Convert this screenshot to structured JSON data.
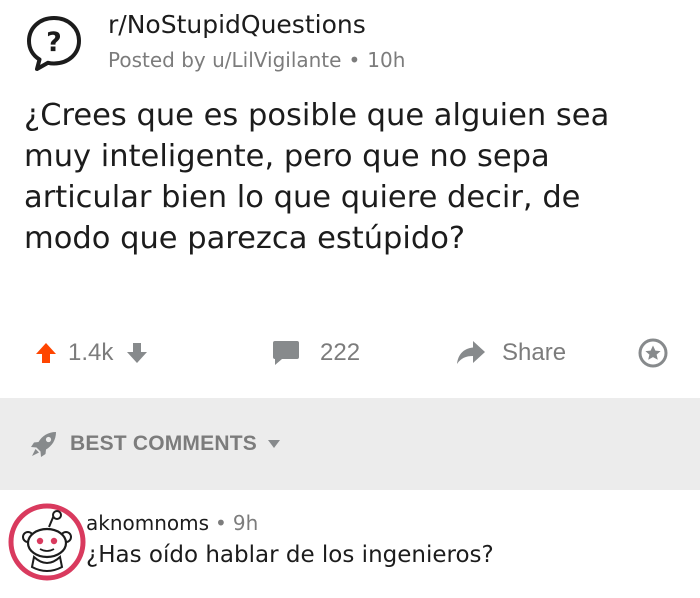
{
  "post": {
    "subreddit": "r/NoStupidQuestions",
    "posted_by_prefix": "Posted by ",
    "author": "u/LilVigilante",
    "separator": "•",
    "age": "10h",
    "title": "¿Crees que es posible que alguien sea muy inteligente, pero que no sepa articular bien lo que quiere decir, de modo que parezca estúpido?"
  },
  "actions": {
    "score": "1.4k",
    "comments": "222",
    "share": "Share"
  },
  "sort": {
    "label": "BEST COMMENTS"
  },
  "comment": {
    "username": "aknomnoms",
    "separator": "•",
    "age": "9h",
    "body": "¿Has oído hablar de los ingenieros?"
  },
  "colors": {
    "upvote_active": "#ff4500",
    "muted_gray": "#878a8c",
    "text": "#1c1c1c",
    "band": "#ececec",
    "avatar_accent": "#d93a5e"
  }
}
